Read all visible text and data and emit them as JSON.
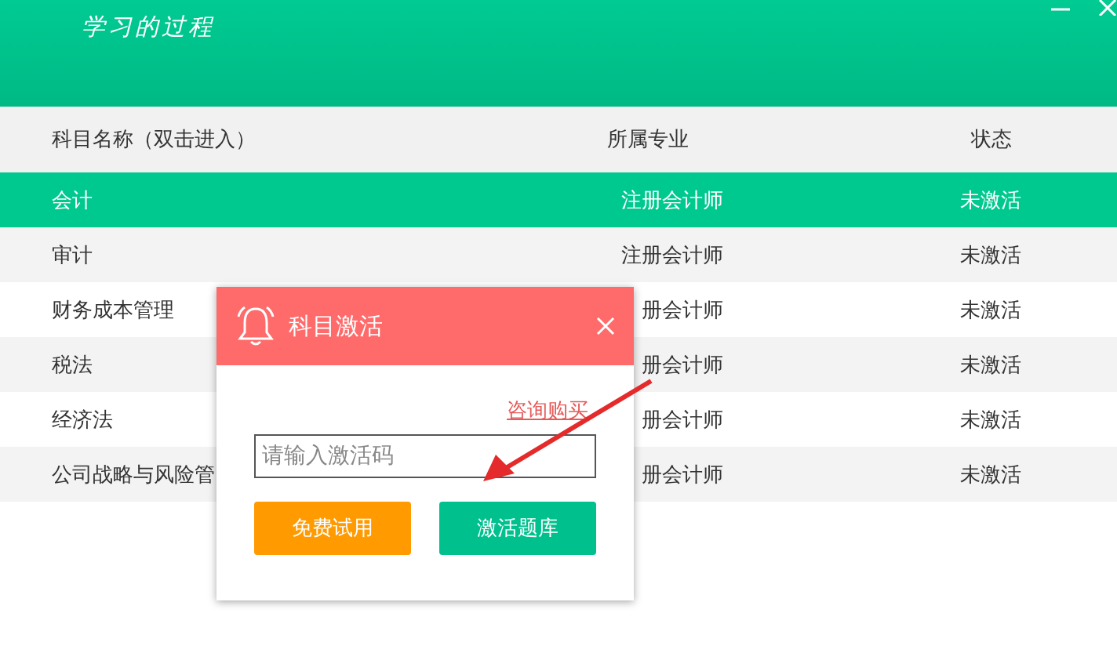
{
  "app": {
    "title": "学习的过程"
  },
  "table": {
    "columns": [
      "科目名称（双击进入）",
      "所属专业",
      "状态"
    ],
    "rows": [
      {
        "name": "会计",
        "major": "注册会计师",
        "status": "未激活",
        "selected": true
      },
      {
        "name": "审计",
        "major": "注册会计师",
        "status": "未激活",
        "selected": false
      },
      {
        "name": "财务成本管理",
        "major": "册会计师",
        "status": "未激活",
        "selected": false
      },
      {
        "name": "税法",
        "major": "册会计师",
        "status": "未激活",
        "selected": false
      },
      {
        "name": "经济法",
        "major": "册会计师",
        "status": "未激活",
        "selected": false
      },
      {
        "name": "公司战略与风险管",
        "major": "册会计师",
        "status": "未激活",
        "selected": false
      }
    ]
  },
  "dialog": {
    "title": "科目激活",
    "link": "咨询购买",
    "placeholder": "请输入激活码",
    "buttons": [
      {
        "label": "免费试用",
        "kind": "trial"
      },
      {
        "label": "激活题库",
        "kind": "activate"
      }
    ]
  }
}
